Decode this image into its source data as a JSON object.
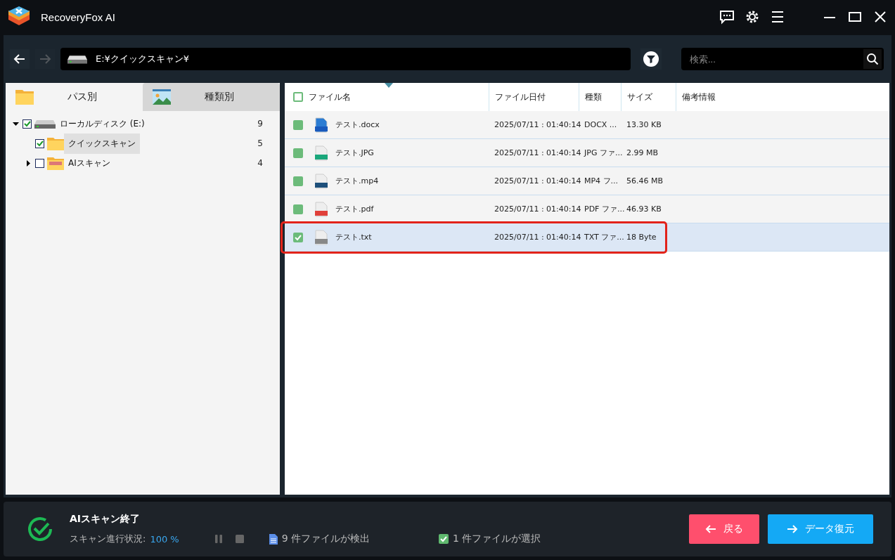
{
  "app": {
    "title": "RecoveryFox AI"
  },
  "toolbar": {
    "path": "E:¥クイックスキャン¥",
    "search_placeholder": "検索..."
  },
  "tabs": [
    {
      "label": "パス別",
      "kind": "folder",
      "selected": true
    },
    {
      "label": "種類別",
      "kind": "picture",
      "selected": false
    }
  ],
  "tree": [
    {
      "label": "ローカルディスク (E:)",
      "count": "9",
      "kind": "drive",
      "checked": true,
      "expanded": true,
      "selected": false,
      "children": [
        {
          "label": "クイックスキャン",
          "count": "5",
          "kind": "folder",
          "checked": true,
          "selected": true
        },
        {
          "label": "AIスキャン",
          "count": "4",
          "kind": "ai-folder",
          "checked": false,
          "expanded": false,
          "selected": false
        }
      ]
    }
  ],
  "table": {
    "header_checked": false,
    "columns": [
      "ファイル名",
      "ファイル日付",
      "種類",
      "サイズ",
      "備考情報"
    ],
    "rows": [
      {
        "kind": "word",
        "name": "テスト.docx",
        "date": "2025/07/11 : 01:40:14",
        "type": "DOCX ...",
        "size": "13.30 KB",
        "checked": false,
        "selected": false,
        "highlighted": false
      },
      {
        "kind": "image",
        "name": "テスト.JPG",
        "date": "2025/07/11 : 01:40:14",
        "type": "JPG ファ...",
        "size": "2.99 MB",
        "checked": false,
        "selected": false,
        "highlighted": false
      },
      {
        "kind": "video",
        "name": "テスト.mp4",
        "date": "2025/07/11 : 01:40:14",
        "type": "MP4 フ...",
        "size": "56.46 MB",
        "checked": false,
        "selected": false,
        "highlighted": false
      },
      {
        "kind": "pdf",
        "name": "テスト.pdf",
        "date": "2025/07/11 : 01:40:14",
        "type": "PDF ファ...",
        "size": "46.93 KB",
        "checked": false,
        "selected": false,
        "highlighted": false
      },
      {
        "kind": "text",
        "name": "テスト.txt",
        "date": "2025/07/11 : 01:40:14",
        "type": "TXT ファ...",
        "size": "18 Byte",
        "checked": true,
        "selected": true,
        "highlighted": true
      }
    ]
  },
  "status": {
    "title": "AIスキャン終了",
    "progress_label": "スキャン進行状況:",
    "progress_value": "100 %",
    "found": "9 件ファイルが検出",
    "selected_count": "1 件ファイルが選択",
    "selected_checked": true
  },
  "buttons": {
    "back": "戻る",
    "recover": "データ復元"
  }
}
